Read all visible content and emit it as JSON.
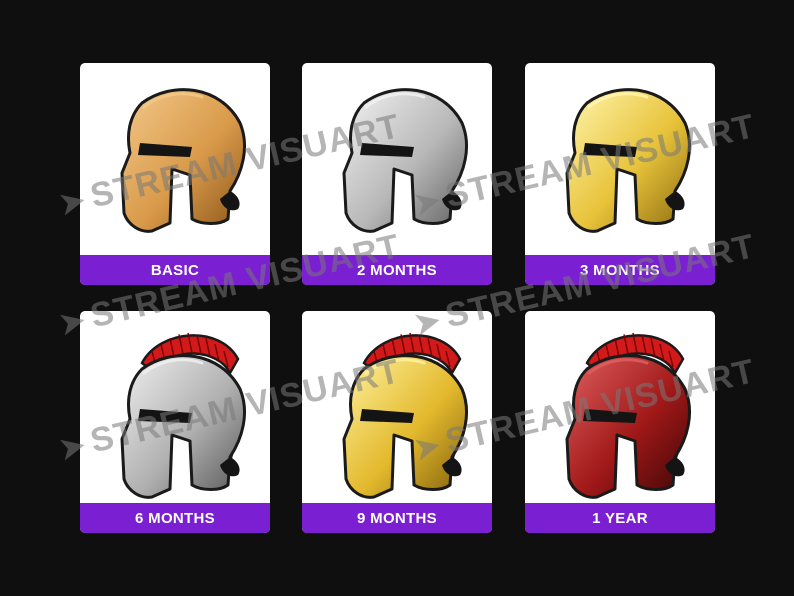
{
  "tiers": [
    {
      "label": "BASIC",
      "variant": "basic",
      "icon": "spartan-helmet-icon",
      "colors": {
        "light": "#f3c98a",
        "mid": "#d99a4a",
        "dark": "#8a5418"
      },
      "crest": false
    },
    {
      "label": "2 MONTHS",
      "variant": "silver",
      "icon": "spartan-helmet-icon",
      "colors": {
        "light": "#f2f2f2",
        "mid": "#b8b8b8",
        "dark": "#5e5e5e"
      },
      "crest": false
    },
    {
      "label": "3 MONTHS",
      "variant": "gold",
      "icon": "spartan-helmet-icon",
      "colors": {
        "light": "#fff6b0",
        "mid": "#e8c33a",
        "dark": "#8a6a10"
      },
      "crest": false
    },
    {
      "label": "6 MONTHS",
      "variant": "silver-crest",
      "icon": "spartan-helmet-crest-icon",
      "colors": {
        "light": "#f0f0f0",
        "mid": "#b0b0b0",
        "dark": "#555555"
      },
      "crest": true
    },
    {
      "label": "9 MONTHS",
      "variant": "gold-crest",
      "icon": "spartan-helmet-crest-icon",
      "colors": {
        "light": "#fff3a0",
        "mid": "#e3b92d",
        "dark": "#7e5e0a"
      },
      "crest": true
    },
    {
      "label": "1 YEAR",
      "variant": "red-crest",
      "icon": "spartan-helmet-crest-icon",
      "colors": {
        "light": "#e06060",
        "mid": "#a01818",
        "dark": "#3a0606"
      },
      "crest": true
    }
  ],
  "watermark": {
    "text": "STREAM VISUART",
    "icon": "stream-visuart-logo-icon"
  },
  "crest_color": "#d31a1a",
  "label_bg": "#7a1fd2",
  "background": "#0f0f0f"
}
